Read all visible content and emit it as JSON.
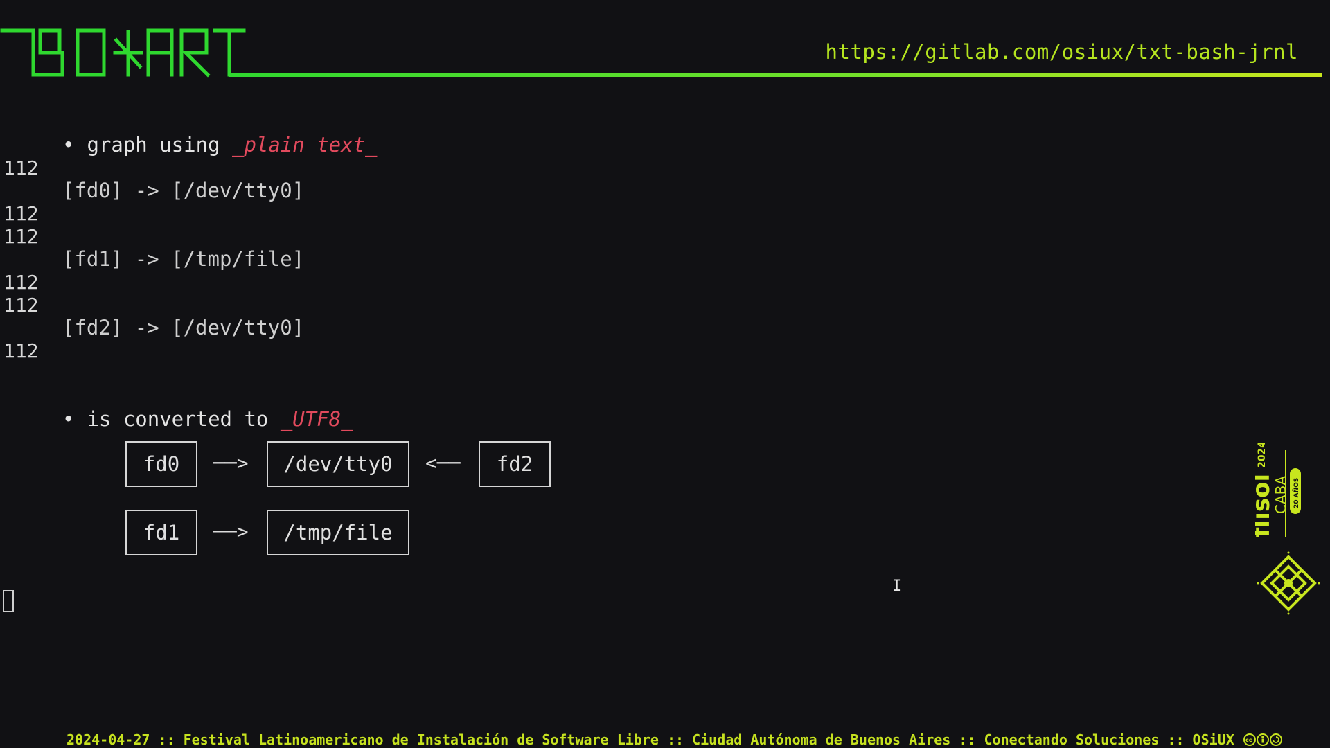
{
  "header": {
    "title": "BOXART",
    "url": "https://gitlab.com/osiux/txt-bash-jrnl"
  },
  "line_numbers": [
    "112",
    "112",
    "112",
    "112",
    "112",
    "112"
  ],
  "content": {
    "bullet1_prefix": "graph using",
    "bullet1_emph": "_plain text_",
    "code_line1": "[fd0] -> [/dev/tty0]",
    "code_line2": "[fd1] -> [/tmp/file]",
    "code_line3": "[fd2] -> [/dev/tty0]",
    "bullet2_prefix": "is converted to",
    "bullet2_emph": "_UTF8_",
    "bullet_glyph": "•"
  },
  "diagram": {
    "box_fd0": "fd0",
    "box_devtty0": "/dev/tty0",
    "box_fd2": "fd2",
    "box_fd1": "fd1",
    "box_tmpfile": "/tmp/file",
    "arrow_right": "──>",
    "arrow_left": "<──"
  },
  "logo": {
    "name": "flisol",
    "year": "2024",
    "city": "CABA",
    "anniversary": "20 AÑOS",
    "icon": "flisol-knot-icon"
  },
  "footer": {
    "text": "2024-04-27 :: Festival Latinoamericano de Instalación de Software Libre :: Ciudad Autónoma de Buenos Aires :: Conectando Soluciones :: OSiUX",
    "license_icons": "cc-by-sa-icons"
  },
  "colors": {
    "background": "#111114",
    "accent_green": "#2fd82f",
    "accent_yellow": "#c8e61e",
    "emphasis": "#e24a5d",
    "text": "#dcdcdc"
  }
}
